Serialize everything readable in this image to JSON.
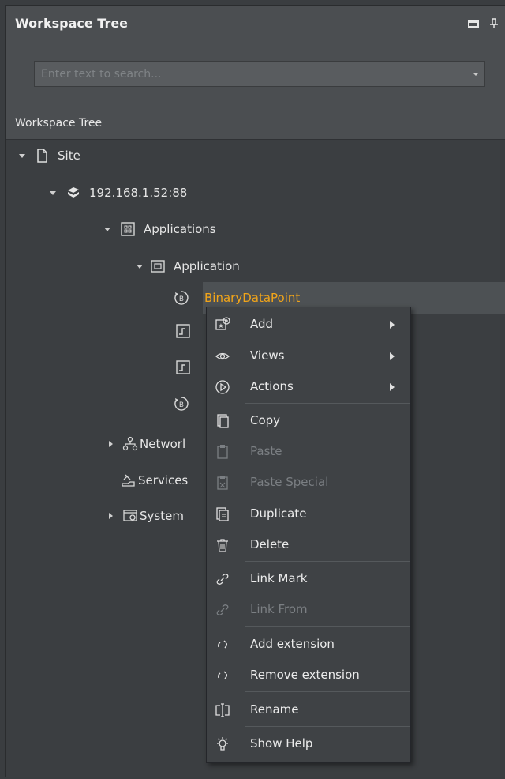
{
  "panel": {
    "title": "Workspace Tree",
    "search_placeholder": "Enter text to search...",
    "tree_header": "Workspace Tree"
  },
  "tree": {
    "site": "Site",
    "host": "192.168.1.52:88",
    "applications": "Applications",
    "application": "Application",
    "binary_data_point": "BinaryDataPoint",
    "networks": "Networl",
    "services": "Services",
    "system": "System"
  },
  "context_menu": {
    "add": "Add",
    "views": "Views",
    "actions": "Actions",
    "copy": "Copy",
    "paste": "Paste",
    "paste_special": "Paste Special",
    "duplicate": "Duplicate",
    "delete": "Delete",
    "link_mark": "Link Mark",
    "link_from": "Link From",
    "add_extension": "Add extension",
    "remove_extension": "Remove extension",
    "rename": "Rename",
    "show_help": "Show Help"
  },
  "colors": {
    "selected_text": "#f2a519",
    "panel_bg": "#3b3e41",
    "header_bg": "#4b4e51"
  }
}
